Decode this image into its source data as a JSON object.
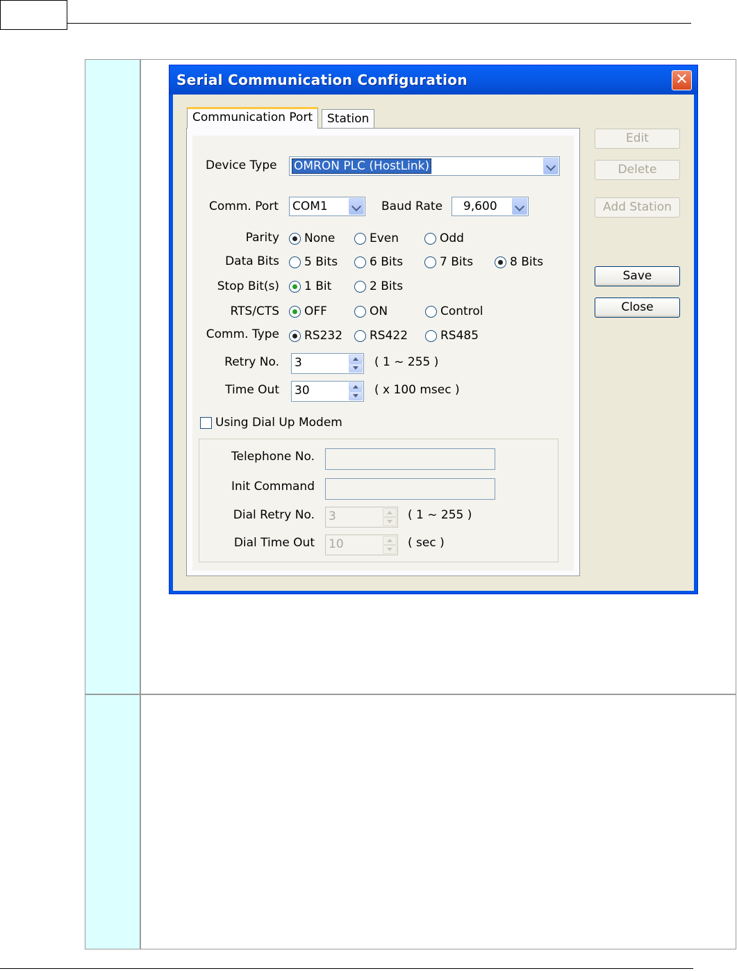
{
  "dialog": {
    "title": "Serial Communication Configuration",
    "close_glyph": "✕",
    "tabs": [
      {
        "label": "Communication Port",
        "active": true
      },
      {
        "label": "Station",
        "active": false
      }
    ],
    "device_type": {
      "label": "Device Type",
      "value": "OMRON PLC (HostLink)"
    },
    "comm_port": {
      "label": "Comm. Port",
      "value": "COM1"
    },
    "baud_rate": {
      "label": "Baud Rate",
      "value": "9,600"
    },
    "parity": {
      "label": "Parity",
      "options": [
        "None",
        "Even",
        "Odd"
      ],
      "selected": "None"
    },
    "data_bits": {
      "label": "Data Bits",
      "options": [
        "5 Bits",
        "6 Bits",
        "7 Bits",
        "8 Bits"
      ],
      "selected": "8 Bits"
    },
    "stop_bits": {
      "label": "Stop Bit(s)",
      "options": [
        "1 Bit",
        "2 Bits"
      ],
      "selected": "1 Bit"
    },
    "rts_cts": {
      "label": "RTS/CTS",
      "options": [
        "OFF",
        "ON",
        "Control"
      ],
      "selected": "OFF"
    },
    "comm_type": {
      "label": "Comm. Type",
      "options": [
        "RS232",
        "RS422",
        "RS485"
      ],
      "selected": "RS232"
    },
    "retry_no": {
      "label": "Retry No.",
      "value": "3",
      "hint": "( 1 ~ 255 )"
    },
    "time_out": {
      "label": "Time Out",
      "value": "30",
      "hint": "( x 100 msec )"
    },
    "dial_up": {
      "checkbox_label": "Using Dial Up Modem",
      "checked": false,
      "telephone_label": "Telephone No.",
      "telephone_value": "",
      "init_label": "Init Command",
      "init_value": "",
      "dial_retry_label": "Dial Retry No.",
      "dial_retry_value": "3",
      "dial_retry_hint": "( 1 ~ 255 )",
      "dial_timeout_label": "Dial Time Out",
      "dial_timeout_value": "10",
      "dial_timeout_hint": "( sec )"
    },
    "buttons": {
      "edit": "Edit",
      "delete": "Delete",
      "add_station": "Add Station",
      "save": "Save",
      "close": "Close"
    }
  },
  "colors": {
    "titlebar": "#0655e0",
    "dialog_face": "#ece9d8",
    "table_cell": "#dcffff",
    "radio_dot": "#21a121"
  }
}
